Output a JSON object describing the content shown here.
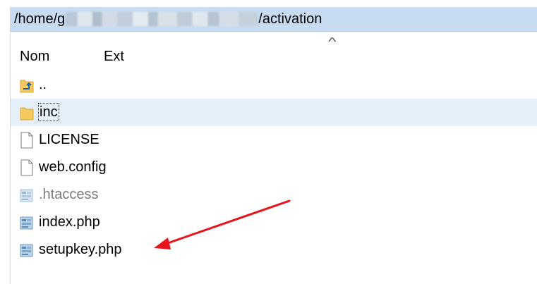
{
  "pathbar": {
    "prefix": "/home/g",
    "suffix": "/activation"
  },
  "columns": {
    "name": "Nom",
    "ext": "Ext",
    "sort_icon": "chevron-up-icon"
  },
  "files": [
    {
      "name": "..",
      "icon": "folder-up-icon",
      "selected": false,
      "dim": false
    },
    {
      "name": "inc",
      "icon": "folder-icon",
      "selected": true,
      "dim": false
    },
    {
      "name": "LICENSE",
      "icon": "file-icon",
      "selected": false,
      "dim": false
    },
    {
      "name": "web.config",
      "icon": "file-icon",
      "selected": false,
      "dim": false
    },
    {
      "name": ".htaccess",
      "icon": "script-file-icon",
      "selected": false,
      "dim": true
    },
    {
      "name": "index.php",
      "icon": "script-file-icon",
      "selected": false,
      "dim": false
    },
    {
      "name": "setupkey.php",
      "icon": "script-file-icon",
      "selected": false,
      "dim": false
    }
  ],
  "colors": {
    "pathbar_bg": "#c7dcf0",
    "selected_row": "#e5f0fb",
    "annotation_arrow": "#e8141c"
  }
}
